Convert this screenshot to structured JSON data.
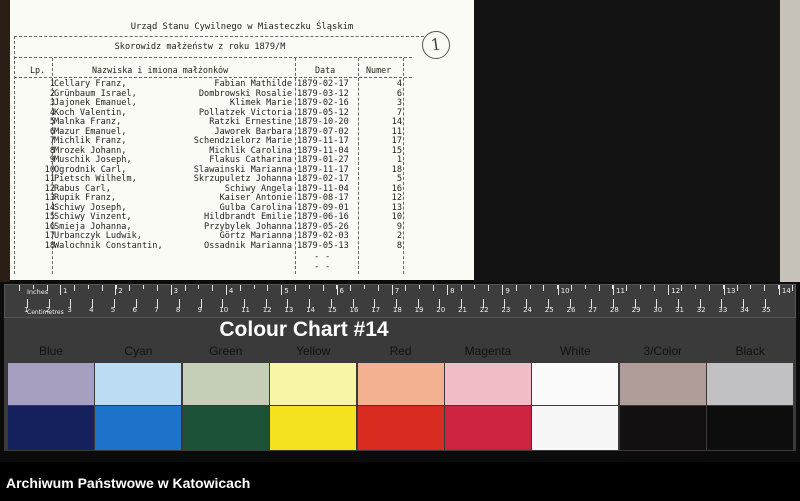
{
  "document": {
    "office": "Urząd Stanu Cywilnego w Miasteczku Śląskim",
    "subtitle": "Skorowidz małżeństw z roku 1879/M",
    "page_number": "1",
    "headers": {
      "lp": "Lp.",
      "names": "Nazwiska i imiona małżonków",
      "date": "Data",
      "number": "Numer"
    },
    "rows": [
      {
        "lp": "1",
        "name1": "Cellary Franz,",
        "name2": "Fabian Mathilde",
        "date": "1879-02-17",
        "num": "4"
      },
      {
        "lp": "2",
        "name1": "Grünbaum Israel,",
        "name2": "Dombrowski Rosalie",
        "date": "1879-03-12",
        "num": "6"
      },
      {
        "lp": "3",
        "name1": "Jajonek Emanuel,",
        "name2": "Klimek Marie",
        "date": "1879-02-16",
        "num": "3"
      },
      {
        "lp": "4",
        "name1": "Koch Valentin,",
        "name2": "Pollatzek Victoria",
        "date": "1879-05-12",
        "num": "7"
      },
      {
        "lp": "5",
        "name1": "Malnka Franz,",
        "name2": "Ratzki Ernestine",
        "date": "1879-10-20",
        "num": "14"
      },
      {
        "lp": "6",
        "name1": "Mazur Emanuel,",
        "name2": "Jaworek Barbara",
        "date": "1879-07-02",
        "num": "11"
      },
      {
        "lp": "7",
        "name1": "Michlik Franz,",
        "name2": "Schendzielorz Marie",
        "date": "1879-11-17",
        "num": "17"
      },
      {
        "lp": "8",
        "name1": "Mrozek Johann,",
        "name2": "Michlik Carolina",
        "date": "1879-11-04",
        "num": "15"
      },
      {
        "lp": "9",
        "name1": "Muschik Joseph,",
        "name2": "Flakus Catharina",
        "date": "1879-01-27",
        "num": "1"
      },
      {
        "lp": "10",
        "name1": "Ogrodnik Carl,",
        "name2": "Slawainski Marianna",
        "date": "1879-11-17",
        "num": "18"
      },
      {
        "lp": "11",
        "name1": "Pietsch Wilhelm,",
        "name2": "Skrzupuletz Johanna",
        "date": "1879-02-17",
        "num": "5"
      },
      {
        "lp": "12",
        "name1": "Rabus Carl,",
        "name2": "Schiwy Angela",
        "date": "1879-11-04",
        "num": "16"
      },
      {
        "lp": "13",
        "name1": "Rupik Franz,",
        "name2": "Kaiser Antonie",
        "date": "1879-08-17",
        "num": "12"
      },
      {
        "lp": "14",
        "name1": "Schiwy Joseph,",
        "name2": "Gulba Carolina",
        "date": "1879-09-01",
        "num": "13"
      },
      {
        "lp": "15",
        "name1": "Schiwy Vinzent,",
        "name2": "Hildbrandt Emilie",
        "date": "1879-06-16",
        "num": "10"
      },
      {
        "lp": "16",
        "name1": "Smieja Johanna,",
        "name2": "Przybylek Johanna",
        "date": "1879-05-26",
        "num": "9"
      },
      {
        "lp": "17",
        "name1": "Urbanczyk Ludwik,",
        "name2": "Görtz Marianna",
        "date": "1879-02-03",
        "num": "2"
      },
      {
        "lp": "18",
        "name1": "Walochnik Constantin,",
        "name2": "Ossadnik Marianna",
        "date": "1879-05-13",
        "num": "8"
      }
    ],
    "empty_marks": [
      "- -",
      "- -"
    ]
  },
  "ruler": {
    "inches_label": "Inches",
    "cm_label": "Centimetres",
    "inch_numbers": [
      "1",
      "2",
      "3",
      "4",
      "5",
      "6",
      "7",
      "8",
      "9",
      "10",
      "11",
      "12",
      "13",
      "14"
    ],
    "cm_numbers": [
      "1",
      "2",
      "3",
      "4",
      "5",
      "6",
      "7",
      "8",
      "9",
      "10",
      "11",
      "12",
      "13",
      "14",
      "15",
      "16",
      "17",
      "18",
      "19",
      "20",
      "21",
      "22",
      "23",
      "24",
      "25",
      "26",
      "27",
      "28",
      "29",
      "30",
      "31",
      "32",
      "33",
      "34",
      "35"
    ]
  },
  "colour_chart": {
    "title": "Colour Chart #14",
    "swatches": [
      {
        "label": "Blue",
        "light": "#a79fbf",
        "dark": "#15215c"
      },
      {
        "label": "Cyan",
        "light": "#bcdcf4",
        "dark": "#1d73c9"
      },
      {
        "label": "Green",
        "light": "#c5cfb8",
        "dark": "#1c5338"
      },
      {
        "label": "Yellow",
        "light": "#f8f5a6",
        "dark": "#f5e21e"
      },
      {
        "label": "Red",
        "light": "#f4b18f",
        "dark": "#d92a1f"
      },
      {
        "label": "Magenta",
        "light": "#f1bcc6",
        "dark": "#cd2341"
      },
      {
        "label": "White",
        "light": "#fbfbfb",
        "dark": "#f7f7f7"
      },
      {
        "label": "3/Color",
        "light": "#b09d99",
        "dark": "#141012"
      },
      {
        "label": "Black",
        "light": "#c1c1c3",
        "dark": "#0d0d0e"
      }
    ]
  },
  "footer": {
    "archive": "Archiwum Państwowe w Katowicach"
  }
}
